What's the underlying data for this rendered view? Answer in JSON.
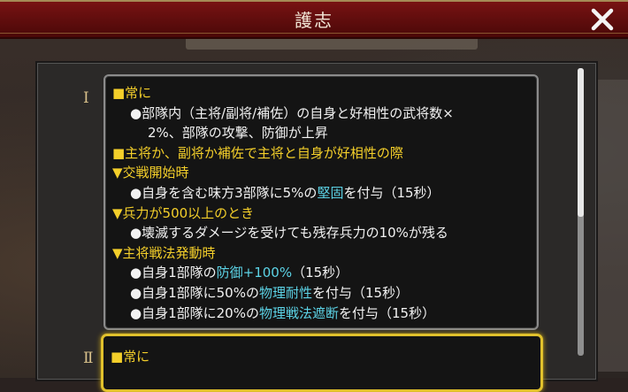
{
  "window": {
    "title": "護志"
  },
  "skill_1": {
    "numeral": "Ⅰ",
    "lines": [
      {
        "type": "head",
        "text": "■常に"
      },
      {
        "type": "ind",
        "parts": [
          {
            "t": "●部隊内（主将/副将/補佐）の自身と好相性の武将数×"
          }
        ]
      },
      {
        "type": "ind2",
        "parts": [
          {
            "t": "2%、部隊の攻撃、防御が上昇"
          }
        ]
      },
      {
        "type": "head",
        "text": "■主将か、副将か補佐で主将と自身が好相性の際"
      },
      {
        "type": "head",
        "text": "▼交戦開始時"
      },
      {
        "type": "ind",
        "parts": [
          {
            "t": "●自身を含む味方3部隊に5%の"
          },
          {
            "t": "堅固",
            "hl": true
          },
          {
            "t": "を付与（15秒）"
          }
        ]
      },
      {
        "type": "head",
        "text": "▼兵力が500以上のとき"
      },
      {
        "type": "ind",
        "parts": [
          {
            "t": "●壊滅するダメージを受けても残存兵力の10%が残る"
          }
        ]
      },
      {
        "type": "head",
        "text": "▼主将戦法発動時"
      },
      {
        "type": "ind",
        "parts": [
          {
            "t": "●自身1部隊の"
          },
          {
            "t": "防御+100%",
            "hl": true
          },
          {
            "t": "（15秒）"
          }
        ]
      },
      {
        "type": "ind",
        "parts": [
          {
            "t": "●自身1部隊に50%の"
          },
          {
            "t": "物理耐性",
            "hl": true
          },
          {
            "t": "を付与（15秒）"
          }
        ]
      },
      {
        "type": "ind",
        "parts": [
          {
            "t": "●自身1部隊に20%の"
          },
          {
            "t": "物理戦法遮断",
            "hl": true
          },
          {
            "t": "を付与（15秒）"
          }
        ]
      }
    ]
  },
  "skill_2": {
    "numeral": "Ⅱ",
    "lines": [
      {
        "type": "head",
        "text": "■常に"
      }
    ]
  },
  "colors": {
    "heading": "#f4cf2a",
    "highlight": "#5cd3e6",
    "selected_border": "#e1c12c"
  },
  "icons": {
    "close": "close-x-icon"
  },
  "scroll": {
    "position_fraction": 0
  }
}
